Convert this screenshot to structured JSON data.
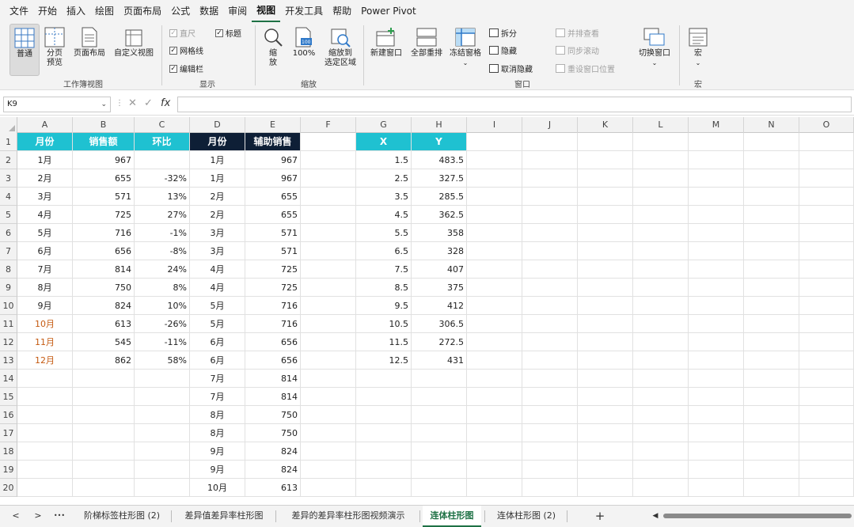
{
  "menu": [
    "文件",
    "开始",
    "插入",
    "绘图",
    "页面布局",
    "公式",
    "数据",
    "审阅",
    "视图",
    "开发工具",
    "帮助",
    "Power Pivot"
  ],
  "ribbon": {
    "workbook_views": {
      "normal": "普通",
      "page_break": "分页\n预览",
      "page_layout": "页面布局",
      "custom_views": "自定义视图",
      "group": "工作簿视图"
    },
    "show": {
      "ruler": "直尺",
      "headings": "标题",
      "gridlines": "网格线",
      "formula_bar": "编辑栏",
      "group": "显示"
    },
    "zoom": {
      "zoom": "缩\n放",
      "zoom100": "100%",
      "zoom_sel": "缩放到\n选定区域",
      "group": "缩放"
    },
    "window": {
      "new_window": "新建窗口",
      "arrange_all": "全部重排",
      "freeze_panes": "冻结窗格",
      "split": "拆分",
      "hide": "隐藏",
      "unhide": "取消隐藏",
      "side_by_side": "并排查看",
      "sync_scroll": "同步滚动",
      "reset_pos": "重设窗口位置",
      "switch": "切换窗口",
      "group": "窗口"
    },
    "macros": {
      "macros": "宏",
      "group": "宏"
    }
  },
  "namebox": "K9",
  "columns": [
    "A",
    "B",
    "C",
    "D",
    "E",
    "F",
    "G",
    "H",
    "I",
    "J",
    "K",
    "L",
    "M",
    "N",
    "O"
  ],
  "rows": [
    "1",
    "2",
    "3",
    "4",
    "5",
    "6",
    "7",
    "8",
    "9",
    "10",
    "11",
    "12",
    "13",
    "14",
    "15",
    "16",
    "17",
    "18",
    "19",
    "20"
  ],
  "table1": {
    "headers": [
      "月份",
      "销售额",
      "环比"
    ],
    "rows": [
      [
        "1月",
        "967",
        ""
      ],
      [
        "2月",
        "655",
        "-32%"
      ],
      [
        "3月",
        "571",
        "13%"
      ],
      [
        "4月",
        "725",
        "27%"
      ],
      [
        "5月",
        "716",
        "-1%"
      ],
      [
        "6月",
        "656",
        "-8%"
      ],
      [
        "7月",
        "814",
        "24%"
      ],
      [
        "8月",
        "750",
        "8%"
      ],
      [
        "9月",
        "824",
        "10%"
      ],
      [
        "10月",
        "613",
        "-26%"
      ],
      [
        "11月",
        "545",
        "-11%"
      ],
      [
        "12月",
        "862",
        "58%"
      ]
    ]
  },
  "table2": {
    "headers": [
      "月份",
      "辅助销售"
    ],
    "rows": [
      [
        "1月",
        "967"
      ],
      [
        "1月",
        "967"
      ],
      [
        "2月",
        "655"
      ],
      [
        "2月",
        "655"
      ],
      [
        "3月",
        "571"
      ],
      [
        "3月",
        "571"
      ],
      [
        "4月",
        "725"
      ],
      [
        "4月",
        "725"
      ],
      [
        "5月",
        "716"
      ],
      [
        "5月",
        "716"
      ],
      [
        "6月",
        "656"
      ],
      [
        "6月",
        "656"
      ],
      [
        "7月",
        "814"
      ],
      [
        "7月",
        "814"
      ],
      [
        "8月",
        "750"
      ],
      [
        "8月",
        "750"
      ],
      [
        "9月",
        "824"
      ],
      [
        "9月",
        "824"
      ],
      [
        "10月",
        "613"
      ]
    ]
  },
  "table3": {
    "headers": [
      "X",
      "Y"
    ],
    "rows": [
      [
        "1.5",
        "483.5"
      ],
      [
        "2.5",
        "327.5"
      ],
      [
        "3.5",
        "285.5"
      ],
      [
        "4.5",
        "362.5"
      ],
      [
        "5.5",
        "358"
      ],
      [
        "6.5",
        "328"
      ],
      [
        "7.5",
        "407"
      ],
      [
        "8.5",
        "375"
      ],
      [
        "9.5",
        "412"
      ],
      [
        "10.5",
        "306.5"
      ],
      [
        "11.5",
        "272.5"
      ],
      [
        "12.5",
        "431"
      ]
    ]
  },
  "sheet_tabs": [
    "阶梯标签柱形图 (2)",
    "差异值差异率柱形图",
    "差异的差异率柱形图视频演示",
    "连体柱形图",
    "连体柱形图 (2)"
  ],
  "active_tab": "连体柱形图",
  "tab_nav": {
    "prev": "<",
    "next": ">",
    "more": "•••",
    "add": "+"
  },
  "colors": {
    "cyan": "#1fc1d1",
    "navy": "#0e1f36",
    "accent": "#1e7145"
  }
}
